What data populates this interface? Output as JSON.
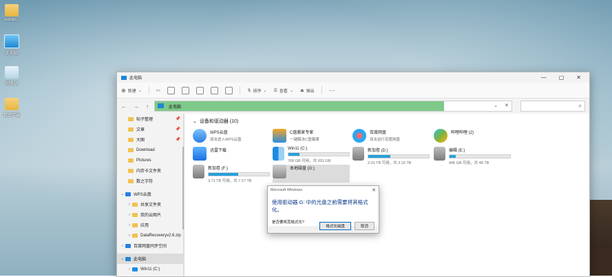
{
  "desktop": {
    "icons": [
      {
        "label": "Admini..."
      },
      {
        "label": "此电脑"
      },
      {
        "label": "回收站"
      },
      {
        "label": "数之宇宙"
      }
    ]
  },
  "window": {
    "title": "此电脑",
    "controls": {
      "minimize": "—",
      "maximize": "▢",
      "close": "✕"
    }
  },
  "toolbar": {
    "new_label": "新建",
    "sort_label": "排序",
    "view_label": "查看",
    "eject_label": "弹出",
    "more_label": "···"
  },
  "navbar": {
    "address": "此电脑",
    "address_progress_percent": 81,
    "search_placeholder": ""
  },
  "sidebar": {
    "items": [
      {
        "label": "帖子整理",
        "pin": "📌"
      },
      {
        "label": "文章",
        "pin": "📌"
      },
      {
        "label": "大图",
        "pin": "📌"
      },
      {
        "label": "Download",
        "pin": ""
      },
      {
        "label": "Pictures",
        "pin": ""
      },
      {
        "label": "内存卡文件夹",
        "pin": ""
      },
      {
        "label": "数之字符",
        "pin": ""
      },
      {
        "label": "WPS云盘",
        "pin": ""
      },
      {
        "label": "共享文件夹",
        "pin": ""
      },
      {
        "label": "我的云图片",
        "pin": ""
      },
      {
        "label": "应用",
        "pin": ""
      },
      {
        "label": "DataRecoveryv2.6.zip",
        "pin": ""
      },
      {
        "label": "百度网盘同步空间",
        "pin": ""
      },
      {
        "label": "此电脑",
        "pin": ""
      },
      {
        "label": "Win11 (C:)",
        "pin": ""
      }
    ]
  },
  "content": {
    "section_title": "设备和驱动器 (10)",
    "devices": [
      {
        "name": "WPS云盘",
        "sub": "双击进入WPS云盘"
      },
      {
        "name": "C盘搬家专家",
        "sub": "一键解决C盘爆满"
      },
      {
        "name": "百度网盘",
        "sub": "双击运行百度网盘"
      },
      {
        "name": "哔哩哔哩 (2)",
        "sub": ""
      },
      {
        "name": "迅雷下载",
        "sub": ""
      }
    ],
    "drives": [
      {
        "name": "Win11 (C:)",
        "free": "768 GB 可用，共 931 GB",
        "used": 0.18
      },
      {
        "name": "新加卷 (D:)",
        "free": "2.01 TB 可用，共 3.16 TB",
        "used": 0.36
      },
      {
        "name": "编辑 (E:)",
        "free": "445 GB 可用，共 48 TB",
        "used": 0.1
      },
      {
        "name": "新加卷 (F:)",
        "free": "3.71 TB 可用，共 7.27 TB",
        "used": 0.49
      },
      {
        "name": "本地磁盘 (G:)",
        "free": "",
        "used": 0
      }
    ]
  },
  "dialog": {
    "title": "Microsoft Windows",
    "close": "✕",
    "message": "使用驱动器 G: 中的光盘之前需要将其格式化。",
    "question": "是否要将其格式化?",
    "format_button": "格式化磁盘",
    "cancel_button": "取消"
  },
  "colors": {
    "address_fill": "#7ec989",
    "drive_bar": "#26a0da",
    "dialog_text": "#0a3a8a"
  }
}
